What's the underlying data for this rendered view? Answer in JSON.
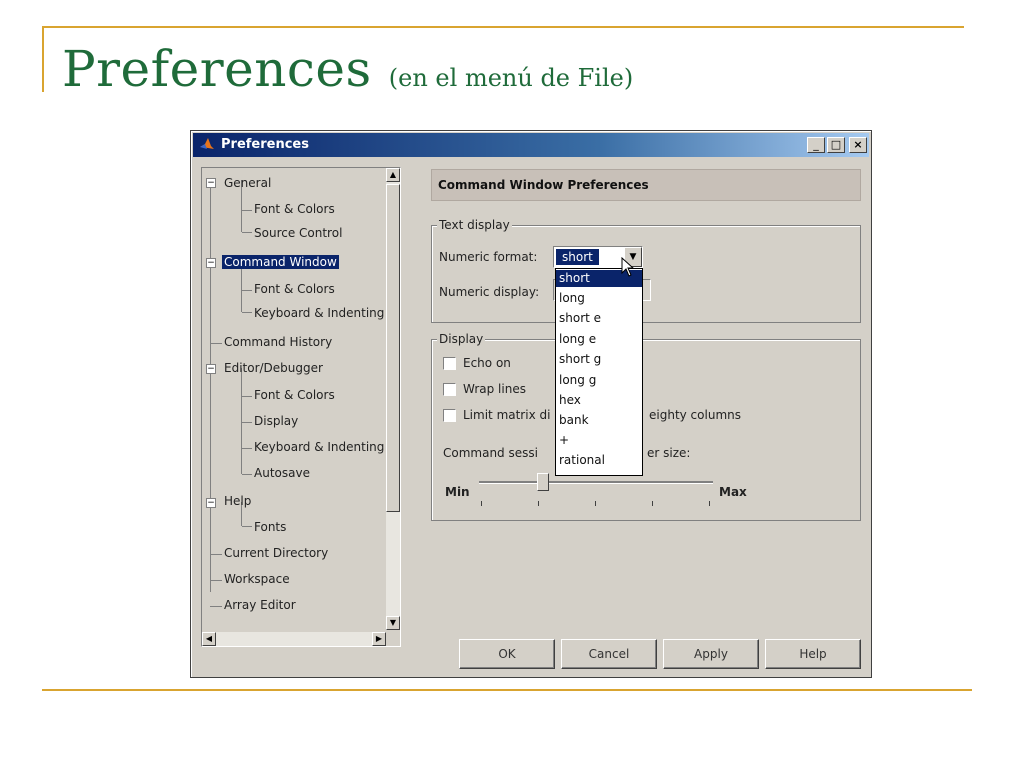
{
  "slide": {
    "title": "Preferences",
    "subtitle": "(en el menú de File)"
  },
  "dialog": {
    "title": "Preferences",
    "window_buttons": {
      "minimize": "_",
      "maximize": "□",
      "close": "×"
    },
    "tree": {
      "items": [
        {
          "label": "General"
        },
        {
          "label": "Font & Colors"
        },
        {
          "label": "Source Control"
        },
        {
          "label": "Command Window"
        },
        {
          "label": "Font & Colors"
        },
        {
          "label": "Keyboard & Indenting"
        },
        {
          "label": "Command History"
        },
        {
          "label": "Editor/Debugger"
        },
        {
          "label": "Font & Colors"
        },
        {
          "label": "Display"
        },
        {
          "label": "Keyboard & Indenting"
        },
        {
          "label": "Autosave"
        },
        {
          "label": "Help"
        },
        {
          "label": "Fonts"
        },
        {
          "label": "Current Directory"
        },
        {
          "label": "Workspace"
        },
        {
          "label": "Array Editor"
        }
      ],
      "selected": "Command Window"
    },
    "panel_title": "Command Window Preferences",
    "text_display": {
      "legend": "Text display",
      "numeric_format_label": "Numeric format:",
      "numeric_format_value": "short",
      "numeric_display_label": "Numeric display:",
      "numeric_format_options": [
        "short",
        "long",
        "short e",
        "long e",
        "short g",
        "long g",
        "hex",
        "bank",
        "+",
        "rational"
      ]
    },
    "display": {
      "legend": "Display",
      "echo_on": "Echo on",
      "wrap_lines": "Wrap lines",
      "limit_matrix_prefix": "Limit matrix di",
      "limit_matrix_suffix": "eighty columns",
      "buffer_prefix": "Command sessi",
      "buffer_suffix": "er size:",
      "slider_min": "Min",
      "slider_max": "Max"
    },
    "buttons": {
      "ok": "OK",
      "cancel": "Cancel",
      "apply": "Apply",
      "help": "Help"
    }
  }
}
